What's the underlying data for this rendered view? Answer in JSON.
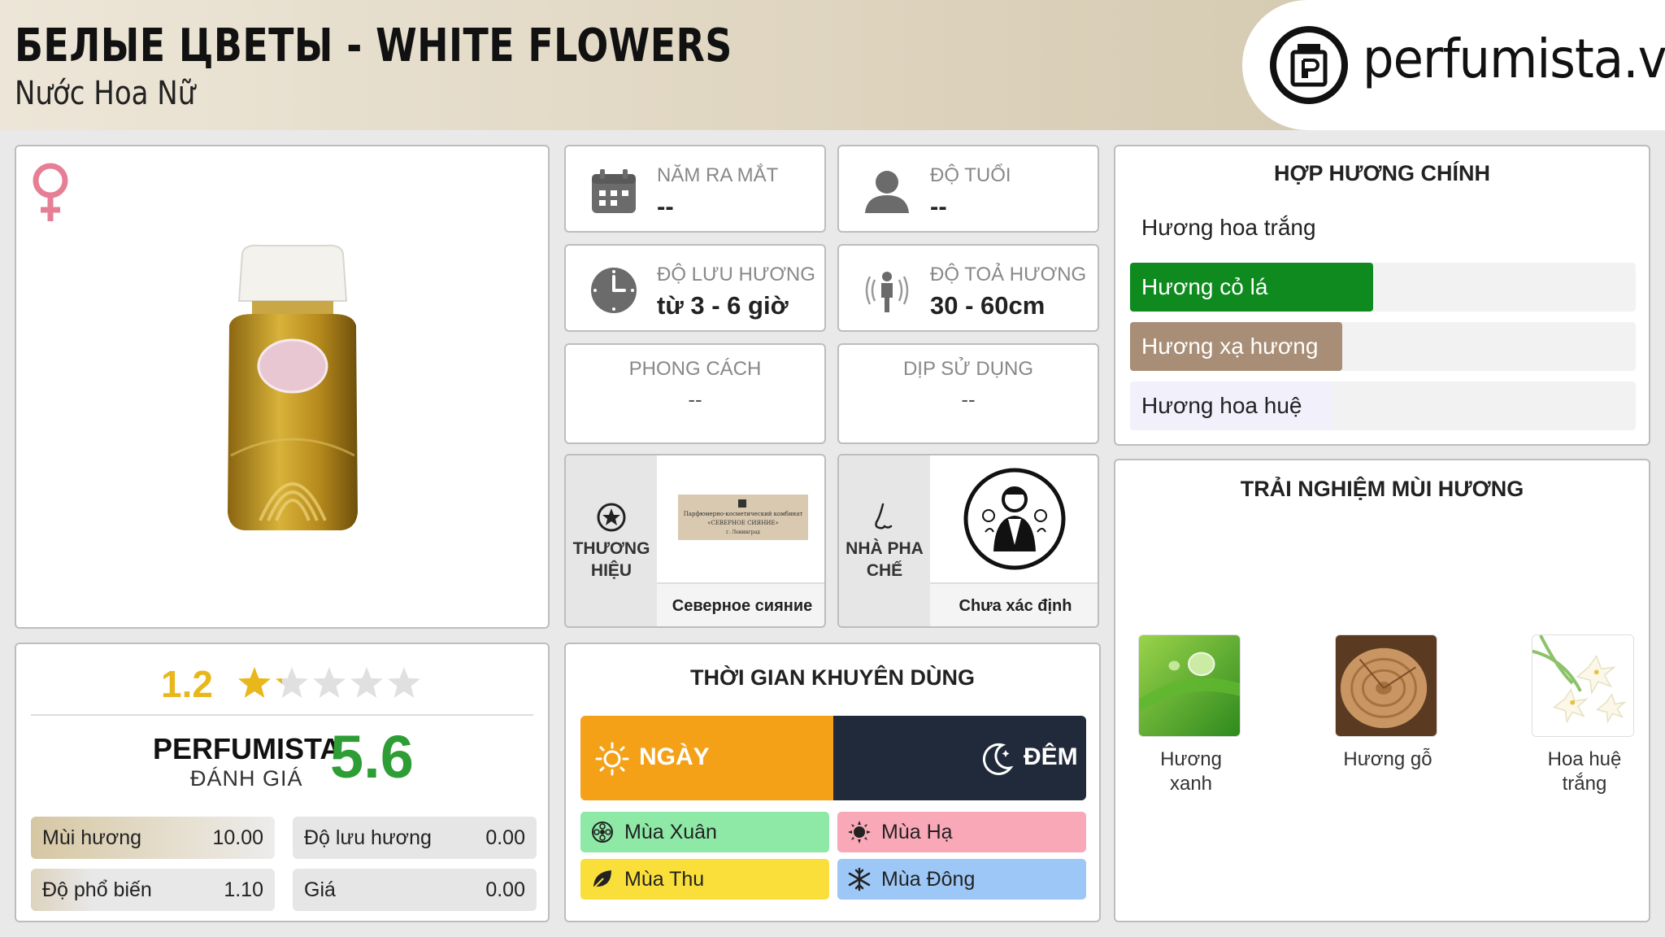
{
  "header": {
    "title": "БЕЛЫЕ ЦВЕТЫ - WHITE FLOWERS",
    "subtitle": "Nước Hoa Nữ",
    "logo_text": "perfumista.vn"
  },
  "info": {
    "launch_year": {
      "label": "NĂM RA MẮT",
      "value": "--"
    },
    "age": {
      "label": "ĐỘ TUỔI",
      "value": "--"
    },
    "longevity": {
      "label": "ĐỘ LƯU HƯƠNG",
      "value": "từ 3 - 6 giờ"
    },
    "sillage": {
      "label": "ĐỘ TOẢ HƯƠNG",
      "value": "30 - 60cm"
    },
    "style": {
      "label": "PHONG CÁCH",
      "value": "--"
    },
    "occasion": {
      "label": "DỊP SỬ DỤNG",
      "value": "--"
    }
  },
  "brand": {
    "label": "THƯƠNG HIỆU",
    "name": "Северное сияние",
    "logo_lines": [
      "Парфюмерно-косметический комбинат",
      "«СЕВЕРНОЕ СИЯНИЕ»",
      "г. Ленинград"
    ]
  },
  "perfumer": {
    "label": "NHÀ PHA CHẾ",
    "name": "Chưa xác định"
  },
  "main_accords": {
    "title": "HỢP HƯƠNG CHÍNH",
    "items": [
      {
        "label": "Hương hoa trắng",
        "level": 100,
        "color": "#ffffff",
        "text_color": "#222222"
      },
      {
        "label": "Hương cỏ lá",
        "level": 48,
        "color": "#0f8a1f",
        "text_color": "#ffffff"
      },
      {
        "label": "Hương xạ hương",
        "level": 42,
        "color": "#a88e76",
        "text_color": "#ffffff"
      },
      {
        "label": "Hương hoa huệ",
        "level": 40,
        "color": "#f1f0fb",
        "text_color": "#222222"
      }
    ]
  },
  "experience": {
    "title": "TRẢI NGHIỆM MÙI HƯƠNG",
    "items": [
      {
        "label": "Hương xanh",
        "icon": "green-leaf-dew"
      },
      {
        "label": "Hương gỗ",
        "icon": "wood-log"
      },
      {
        "label": "Hoa huệ trắng",
        "icon": "white-lily-flowers"
      }
    ]
  },
  "rating": {
    "value": "1.2",
    "stars_filled": 1.2,
    "stars_total": 5,
    "brand_label": "PERFUMISTA",
    "brand_sub": "ĐÁNH GIÁ",
    "score": "5.6",
    "scores": [
      {
        "name": "Mùi hương",
        "value": "10.00"
      },
      {
        "name": "Độ lưu hương",
        "value": "0.00"
      },
      {
        "name": "Độ phổ biến",
        "value": "1.10"
      },
      {
        "name": "Giá",
        "value": "0.00"
      }
    ]
  },
  "time": {
    "title": "THỜI GIAN KHUYÊN DÙNG",
    "day": "NGÀY",
    "night": "ĐÊM",
    "seasons": {
      "spring": "Mùa Xuân",
      "summer": "Mùa Hạ",
      "autumn": "Mùa Thu",
      "winter": "Mùa Đông"
    }
  },
  "colors": {
    "accent_gold": "#e8b71c",
    "score_green": "#2e9d36",
    "day": "#f4a118",
    "night": "#212a3a",
    "spring": "#8ee8a6",
    "summer": "#f9a8b8",
    "autumn": "#fadf3a",
    "winter": "#9cc7f6"
  }
}
